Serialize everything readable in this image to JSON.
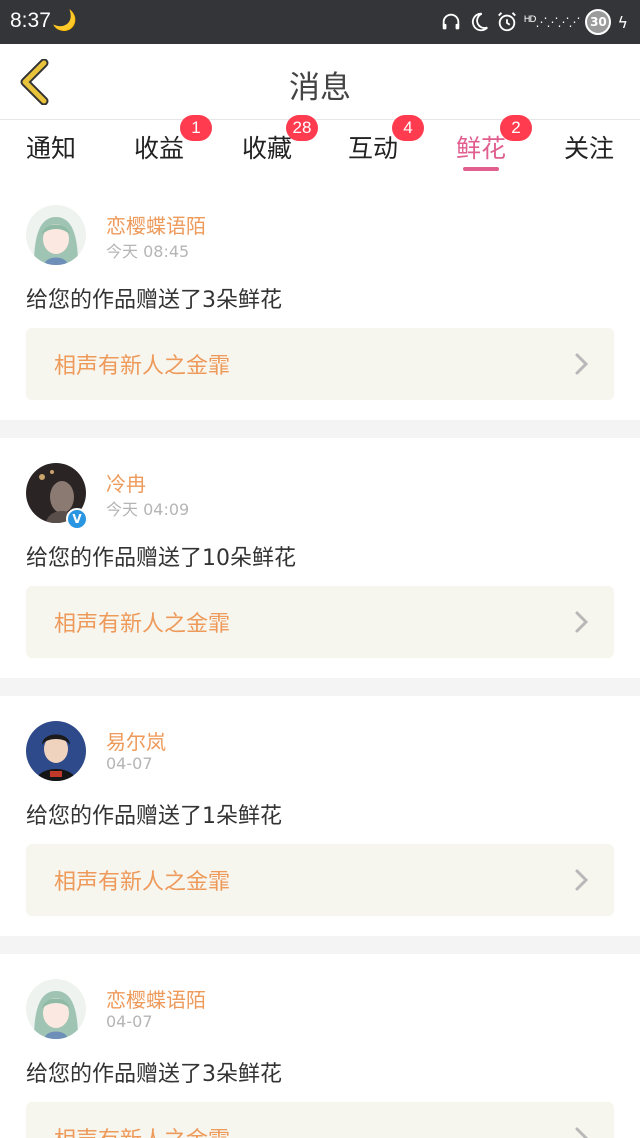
{
  "status_bar": {
    "time": "8:37",
    "moon_glyph": "🌙",
    "network_label": "HD",
    "battery_level": "30",
    "icons": [
      "headset-icon",
      "do-not-disturb-moon-icon",
      "alarm-icon",
      "signal-icon",
      "battery-icon",
      "charging-bolt-icon"
    ]
  },
  "header": {
    "title": "消息",
    "back_icon": "chevron-left-icon",
    "accent_color": "#e8c33b"
  },
  "tabs": [
    {
      "label": "通知",
      "badge": ""
    },
    {
      "label": "收益",
      "badge": "1"
    },
    {
      "label": "收藏",
      "badge": "28"
    },
    {
      "label": "互动",
      "badge": "4"
    },
    {
      "label": "鲜花",
      "badge": "2",
      "active": true
    },
    {
      "label": "关注",
      "badge": ""
    }
  ],
  "colors": {
    "tab_active": "#e05f8e",
    "badge_bg": "#ff3b4f",
    "username": "#ee9a5b",
    "work_title": "#ee9a5b",
    "work_card_bg": "#f6f5ee"
  },
  "messages": [
    {
      "username": "恋樱蝶语陌",
      "time": "今天 08:45",
      "text": "给您的作品赠送了3朵鲜花",
      "work_title": "相声有新人之金霏",
      "verified": false,
      "avatar": "anime-girl-avatar"
    },
    {
      "username": "冷冉",
      "time": "今天 04:09",
      "text": "给您的作品赠送了10朵鲜花",
      "work_title": "相声有新人之金霏",
      "verified": true,
      "avatar": "dark-photo-avatar"
    },
    {
      "username": "易尔岚",
      "time": "04-07",
      "text": "给您的作品赠送了1朵鲜花",
      "work_title": "相声有新人之金霏",
      "verified": false,
      "avatar": "boy-photo-avatar"
    },
    {
      "username": "恋樱蝶语陌",
      "time": "04-07",
      "text": "给您的作品赠送了3朵鲜花",
      "work_title": "相声有新人之金霏",
      "verified": false,
      "avatar": "anime-girl-avatar"
    }
  ]
}
